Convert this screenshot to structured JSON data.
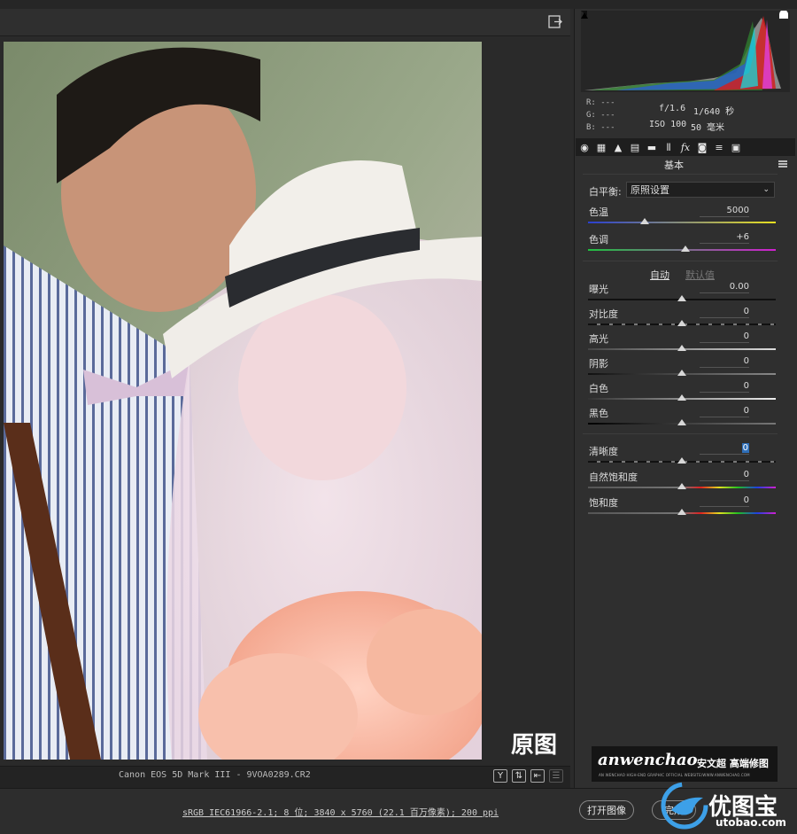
{
  "colors": {
    "panel": "#2f2f2f",
    "canvas": "#2a2a2a",
    "accent": "#2f6fb8"
  },
  "exif": {
    "r_label": "R:",
    "r_value": "---",
    "g_label": "G:",
    "g_value": "---",
    "b_label": "B:",
    "b_value": "---",
    "aperture": "f/1.6",
    "shutter": "1/640 秒",
    "iso": "ISO 100",
    "focal": "50 毫米"
  },
  "panel": {
    "section_title": "基本"
  },
  "white_balance": {
    "label": "白平衡:",
    "value": "原照设置"
  },
  "tone": {
    "auto": "自动",
    "default": "默认值"
  },
  "sliders": [
    {
      "label": "色温",
      "value": "5000",
      "position": 0.3
    },
    {
      "label": "色调",
      "value": "+6",
      "position": 0.52
    },
    {
      "label": "曝光",
      "value": "0.00",
      "position": 0.5
    },
    {
      "label": "对比度",
      "value": "0",
      "position": 0.5
    },
    {
      "label": "高光",
      "value": "0",
      "position": 0.5
    },
    {
      "label": "阴影",
      "value": "0",
      "position": 0.5
    },
    {
      "label": "白色",
      "value": "0",
      "position": 0.5
    },
    {
      "label": "黑色",
      "value": "0",
      "position": 0.5
    },
    {
      "label": "清晰度",
      "value": "0",
      "position": 0.5
    },
    {
      "label": "自然饱和度",
      "value": "0",
      "position": 0.5
    },
    {
      "label": "饱和度",
      "value": "0",
      "position": 0.5
    }
  ],
  "photo": {
    "caption": "原图"
  },
  "footer": {
    "filename": "Canon EOS 5D Mark III -  9VOA0289.CR2",
    "workflow": "sRGB IEC61966-2.1; 8 位; 3840 x 5760 (22.1 百万像素); 200 ppi",
    "open_button": "打开图像",
    "done_button": "完成",
    "view_y": "Y"
  },
  "branding": {
    "logo": "anwenchao",
    "logo_cn": "安文超 高端修图",
    "logo_tagline": "AN WENCHAO HIGH-END GRAPHIC OFFICIAL WEBSITE/WWW.ANWENCHAO.COM",
    "watermark_cn": "优图宝",
    "watermark_url": "utobao.com"
  }
}
